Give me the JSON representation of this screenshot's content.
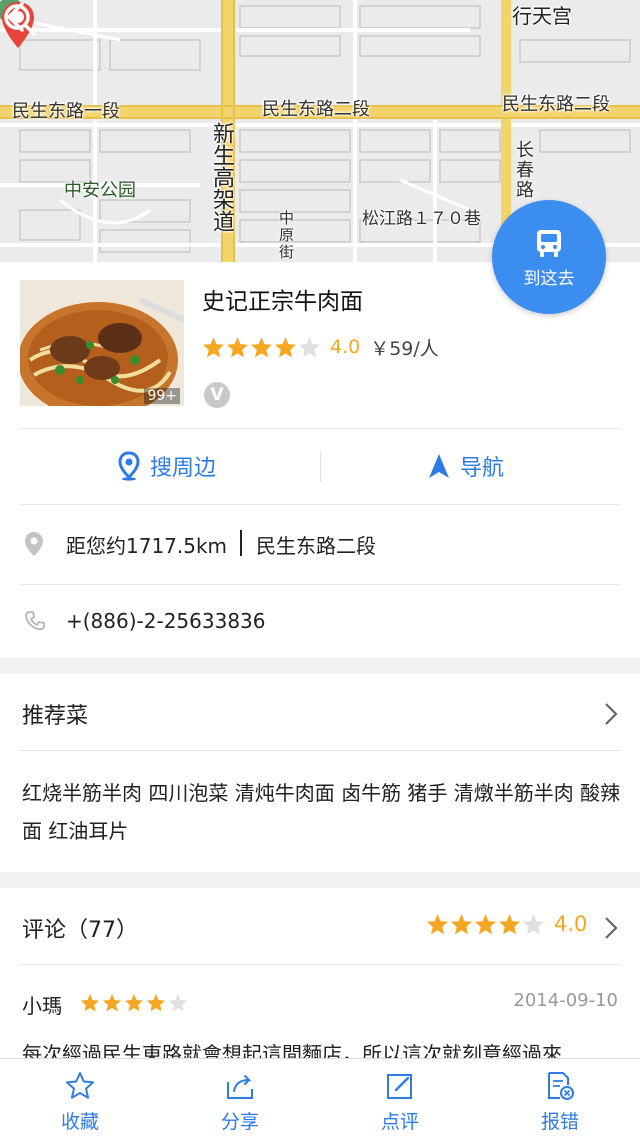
{
  "map": {
    "labels": {
      "road_west": "民生东路一段",
      "road_center": "民生东路二段",
      "road_east": "民生东路二段",
      "expressway": "新生高架道",
      "changchun": "长春路",
      "zhongyuan": "中原街",
      "park": "中安公园",
      "songjiang": "松江路１７０巷",
      "metro_station": "行天宫"
    }
  },
  "shop": {
    "name": "史记正宗牛肉面",
    "photo_count": "99+",
    "rating": 4.0,
    "rating_text": "4.0",
    "price": "￥59/人",
    "badge": "V"
  },
  "route_button": {
    "label": "到这去"
  },
  "actions": {
    "nearby": "搜周边",
    "navigate": "导航"
  },
  "address": {
    "distance": "距您约1717.5km",
    "street": "民生东路二段"
  },
  "phone": "+(886)-2-25633836",
  "recommended": {
    "title": "推荐菜",
    "dishes": "红烧半筋半肉 四川泡菜 清炖牛肉面 卤牛筋 猪手 清燉半筋半肉 酸辣面 红油耳片"
  },
  "comments": {
    "title": "评论（77）",
    "rating": 4.0,
    "rating_text": "4.0",
    "review": {
      "user": "小瑪",
      "stars": 4,
      "date": "2014-09-10",
      "text": "每次經過民生東路就會想起這間麵店，所以這次就刻意經過來"
    }
  },
  "tabbar": {
    "favorite": "收藏",
    "share": "分享",
    "review": "点评",
    "report": "报错"
  },
  "colors": {
    "accent": "#2e7be6",
    "star": "#f5a623",
    "pin": "#e8453c",
    "route_button": "#3b8df0"
  }
}
